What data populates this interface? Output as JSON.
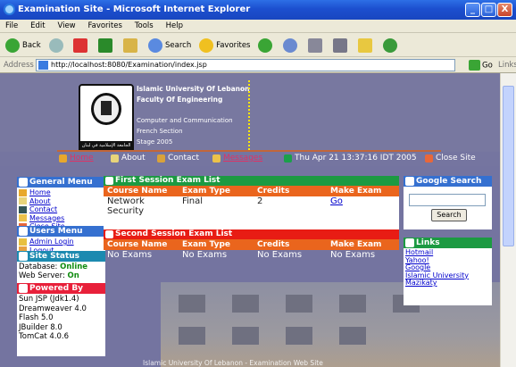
{
  "window": {
    "title": "Examination Site - Microsoft Internet Explorer",
    "buttons": [
      "_",
      "□",
      "X"
    ]
  },
  "menu": [
    "File",
    "Edit",
    "View",
    "Favorites",
    "Tools",
    "Help"
  ],
  "toolbar": {
    "back": "Back",
    "search": "Search",
    "favorites": "Favorites"
  },
  "address": {
    "label": "Address",
    "url": "http://localhost:8080/Examination/index.jsp",
    "go": "Go",
    "links": "Links"
  },
  "header": {
    "university": "Islamic University Of Lebanon",
    "faculty": "Faculty Of Engineering",
    "dept": "Computer and Communication",
    "section": "French Section",
    "stage": "Stage 2005",
    "logo_text": "الجامعة الإسلامية في لبنان"
  },
  "nav": {
    "home": "Home",
    "about": "About",
    "contact": "Contact",
    "messages": "Messages",
    "datetime": "Thu Apr 21 13:37:16 IDT 2005",
    "close": "Close Site"
  },
  "general_menu": {
    "title": "General Menu",
    "items": [
      "Home",
      "About",
      "Contact",
      "Messages",
      "Close Site"
    ]
  },
  "users_menu": {
    "title": "Users Menu",
    "items": [
      "Admin Login",
      "Logout"
    ]
  },
  "site_status": {
    "title": "Site Status",
    "db_label": "Database:",
    "db_value": "Online",
    "ws_label": "Web Server:",
    "ws_value": "On"
  },
  "powered_by": {
    "title": "Powered By",
    "items": [
      "Sun JSP (Jdk1.4)",
      "Dreamweaver 4.0",
      "Flash 5.0",
      "JBuilder 8.0",
      "TomCat 4.0.6"
    ]
  },
  "first_session": {
    "title": "First Session Exam List",
    "columns": [
      "Course Name",
      "Exam Type",
      "Credits",
      "Make Exam"
    ],
    "rows": [
      [
        "Network Security",
        "Final",
        "2",
        "Go"
      ]
    ]
  },
  "second_session": {
    "title": "Second Session Exam List",
    "columns": [
      "Course Name",
      "Exam Type",
      "Credits",
      "Make Exam"
    ],
    "rows": [
      [
        "No Exams",
        "No Exams",
        "No Exams",
        "No Exams"
      ]
    ]
  },
  "google": {
    "title": "Google Search",
    "button": "Search",
    "value": ""
  },
  "links": {
    "title": "Links",
    "items": [
      "Hotmail",
      "Yahoo!",
      "Google",
      "Islamic University",
      "Mazikaty"
    ]
  },
  "footer": "Islamic University Of Lebanon - Examination Web Site",
  "colors": {
    "header_bg": "#7878a0",
    "panel_blue": "#3570d0",
    "green_head": "#1c9a42",
    "red_head": "#e81c14",
    "orange_th": "#ea651d"
  }
}
